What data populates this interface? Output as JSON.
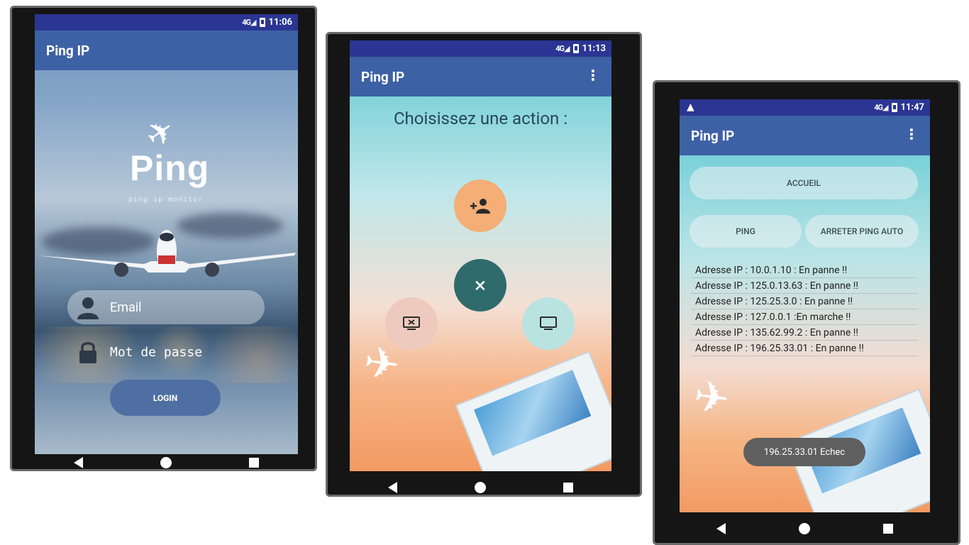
{
  "phone1": {
    "status_time": "11:06",
    "app_title": "Ping IP",
    "logo_title": "Ping",
    "logo_subtitle": "ping ip monitor",
    "email_placeholder": "Email",
    "password_placeholder": "Mot de passe",
    "login_label": "LOGIN"
  },
  "phone2": {
    "status_time": "11:13",
    "app_title": "Ping IP",
    "menu_icon": "⋮",
    "heading": "Choisissez une action :",
    "actions": {
      "add_user_icon": "add-user-icon",
      "close_icon": "×",
      "screen_off_icon": "monitor-x-icon",
      "screen_icon": "monitor-icon"
    },
    "colors": {
      "add_user": "#f4ae76",
      "close": "#2f6b6c",
      "screen_off": "#eec9bd",
      "screen": "#b9e3e1"
    }
  },
  "phone3": {
    "status_time": "11:47",
    "warning_icon": "▲",
    "app_title": "Ping IP",
    "menu_icon": "⋮",
    "home_button": "ACCUEIL",
    "ping_button": "PING",
    "stop_button": "ARRETER PING AUTO",
    "ip_results": [
      "Adresse IP : 10.0.1.10 : En panne !!",
      "Adresse IP : 125.0.13.63 : En panne !!",
      "Adresse IP : 125.25.3.0 : En panne !!",
      "Adresse IP : 127.0.0.1 :En marche !!",
      "Adresse IP : 135.62.99.2 : En panne !!",
      "Adresse IP : 196.25.33.01 : En panne !!"
    ],
    "toast": "196.25.33.01 Echec"
  },
  "colors": {
    "statusbar": "#2b3593",
    "appbar": "#3d61a5",
    "login_button": "#4f6fa3"
  }
}
